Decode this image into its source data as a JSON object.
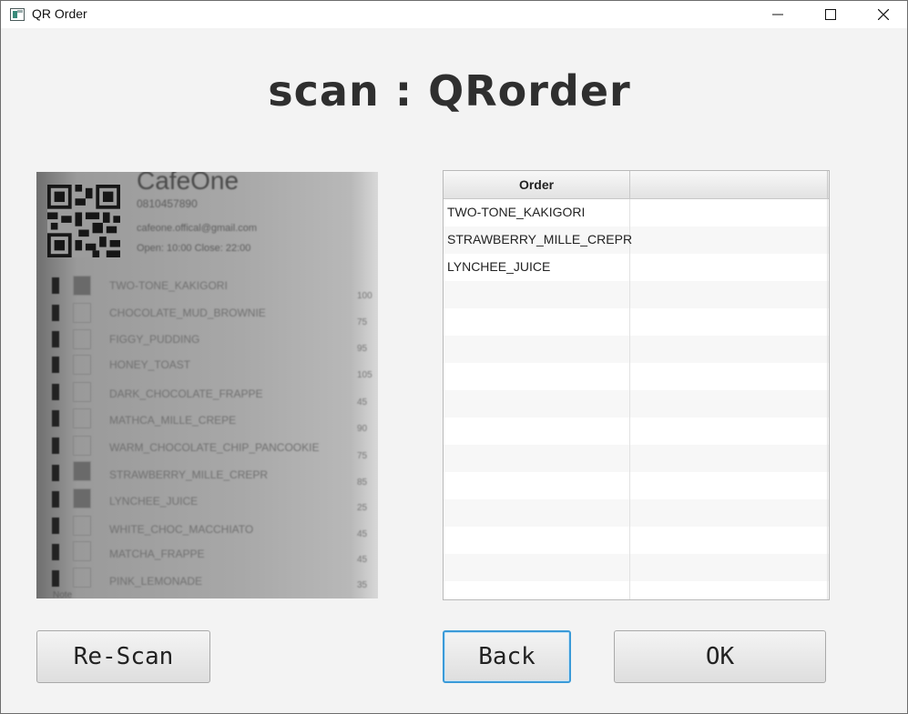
{
  "window": {
    "title": "QR Order"
  },
  "heading": "scan : QRorder",
  "camera_preview": {
    "shop_name": "CafeOne",
    "phone": "0810457890",
    "email": "cafeone.offical@gmail.com",
    "hours": "Open: 10:00 Close: 22:00",
    "menu_items": [
      {
        "name": "TWO-TONE_KAKIGORI",
        "price": "100",
        "checked": true
      },
      {
        "name": "CHOCOLATE_MUD_BROWNIE",
        "price": "75",
        "checked": false
      },
      {
        "name": "FIGGY_PUDDING",
        "price": "95",
        "checked": false
      },
      {
        "name": "HONEY_TOAST",
        "price": "105",
        "checked": false
      },
      {
        "name": "DARK_CHOCOLATE_FRAPPE",
        "price": "45",
        "checked": false
      },
      {
        "name": "MATHCA_MILLE_CREPE",
        "price": "90",
        "checked": false
      },
      {
        "name": "WARM_CHOCOLATE_CHIP_PANCOOKIE",
        "price": "75",
        "checked": false
      },
      {
        "name": "STRAWBERRY_MILLE_CREPR",
        "price": "85",
        "checked": true
      },
      {
        "name": "LYNCHEE_JUICE",
        "price": "25",
        "checked": true
      },
      {
        "name": "WHITE_CHOC_MACCHIATO",
        "price": "45",
        "checked": false
      },
      {
        "name": "MATCHA_FRAPPE",
        "price": "45",
        "checked": false
      },
      {
        "name": "PINK_LEMONADE",
        "price": "35",
        "checked": false
      }
    ],
    "footer_text": "Note"
  },
  "order_table": {
    "columns": [
      "Order",
      ""
    ],
    "rows": [
      [
        "TWO-TONE_KAKIGORI",
        ""
      ],
      [
        "STRAWBERRY_MILLE_CREPR",
        ""
      ],
      [
        "LYNCHEE_JUICE",
        ""
      ],
      [
        "",
        ""
      ],
      [
        "",
        ""
      ],
      [
        "",
        ""
      ],
      [
        "",
        ""
      ],
      [
        "",
        ""
      ],
      [
        "",
        ""
      ],
      [
        "",
        ""
      ],
      [
        "",
        ""
      ],
      [
        "",
        ""
      ],
      [
        "",
        ""
      ],
      [
        "",
        ""
      ],
      [
        "",
        ""
      ]
    ]
  },
  "buttons": {
    "rescan": "Re-Scan",
    "back": "Back",
    "ok": "OK"
  },
  "icons": {
    "minimize": "minimize-icon",
    "maximize": "maximize-icon",
    "close": "close-icon",
    "app": "app-icon"
  },
  "colors": {
    "focus_border": "#3a9ad8",
    "window_bg": "#f3f3f3"
  }
}
